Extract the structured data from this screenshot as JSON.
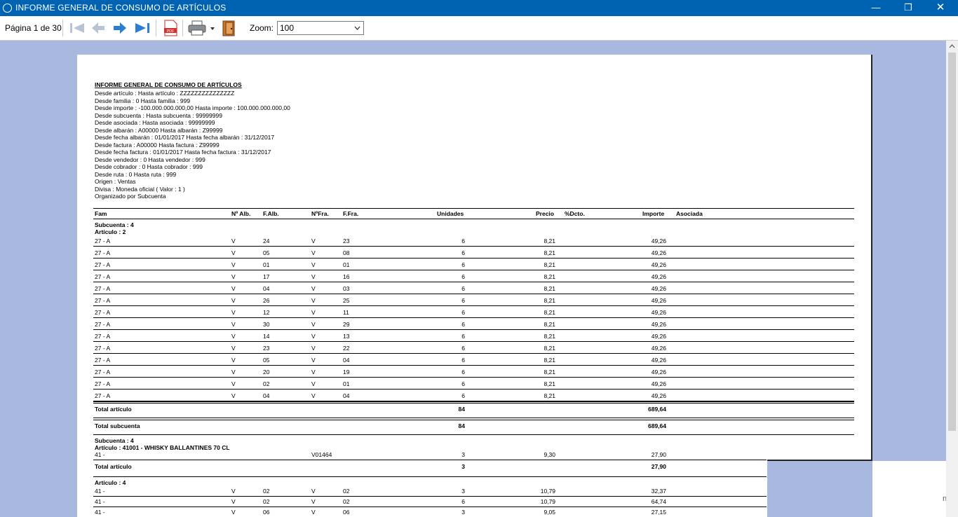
{
  "window": {
    "title": "INFORME GENERAL DE CONSUMO DE ARTÍCULOS"
  },
  "toolbar": {
    "page_indicator": "Página 1 de 30",
    "zoom_label": "Zoom:",
    "zoom_value": "100"
  },
  "report": {
    "title": "INFORME GENERAL DE CONSUMO DE ARTÍCULOS",
    "filters": [
      "Desde artículo :  Hasta artículo : ZZZZZZZZZZZZZZZ",
      "Desde familia : 0 Hasta familia : 999",
      "Desde importe : -100.000.000.000,00 Hasta importe : 100.000.000.000,00",
      "Desde subcuenta :  Hasta subcuenta : 99999999",
      "Desde asociada :  Hasta asociada : 99999999",
      "Desde albarán : A00000 Hasta albarán : Z99999",
      "Desde fecha albarán : 01/01/2017 Hasta fecha albarán : 31/12/2017",
      "Desde factura : A00000 Hasta factura : Z99999",
      "Desde fecha factura : 01/01/2017 Hasta fecha factura : 31/12/2017",
      "Desde vendedor : 0 Hasta vendedor : 999",
      "Desde cobrador : 0 Hasta cobrador : 999",
      "Desde ruta : 0 Hasta ruta : 999",
      "Origen : Ventas",
      "Divisa : Moneda oficial ( Valor : 1 )",
      "Organizado por Subcuenta"
    ],
    "columns": {
      "fam": "Fam",
      "nalb": "Nº Alb.",
      "falb": "F.Alb.",
      "nfra": "NºFra.",
      "ffra": "F.Fra.",
      "unidades": "Unidades",
      "precio": "Precio",
      "dcto": "%Dcto.",
      "importe": "Importe",
      "asociada": "Asociada"
    },
    "group1": {
      "subcuenta": "Subcuenta : 4",
      "articulo": "Artículo : 2",
      "rows": [
        {
          "fam": "27 - A",
          "nalb": "V",
          "falb": "24",
          "nfra": "V",
          "ffra": "23",
          "unidades": "6",
          "precio": "8,21",
          "importe": "49,26"
        },
        {
          "fam": "27 - A",
          "nalb": "V",
          "falb": "05",
          "nfra": "V",
          "ffra": "08",
          "unidades": "6",
          "precio": "8,21",
          "importe": "49,26"
        },
        {
          "fam": "27 - A",
          "nalb": "V",
          "falb": "01",
          "nfra": "V",
          "ffra": "01",
          "unidades": "6",
          "precio": "8,21",
          "importe": "49,26"
        },
        {
          "fam": "27 - A",
          "nalb": "V",
          "falb": "17",
          "nfra": "V",
          "ffra": "16",
          "unidades": "6",
          "precio": "8,21",
          "importe": "49,26"
        },
        {
          "fam": "27 - A",
          "nalb": "V",
          "falb": "04",
          "nfra": "V",
          "ffra": "03",
          "unidades": "6",
          "precio": "8,21",
          "importe": "49,26"
        },
        {
          "fam": "27 - A",
          "nalb": "V",
          "falb": "26",
          "nfra": "V",
          "ffra": "25",
          "unidades": "6",
          "precio": "8,21",
          "importe": "49,26"
        },
        {
          "fam": "27 - A",
          "nalb": "V",
          "falb": "12",
          "nfra": "V",
          "ffra": "11",
          "unidades": "6",
          "precio": "8,21",
          "importe": "49,26"
        },
        {
          "fam": "27 - A",
          "nalb": "V",
          "falb": "30",
          "nfra": "V",
          "ffra": "29",
          "unidades": "6",
          "precio": "8,21",
          "importe": "49,26"
        },
        {
          "fam": "27 - A",
          "nalb": "V",
          "falb": "14",
          "nfra": "V",
          "ffra": "13",
          "unidades": "6",
          "precio": "8,21",
          "importe": "49,26"
        },
        {
          "fam": "27 - A",
          "nalb": "V",
          "falb": "23",
          "nfra": "V",
          "ffra": "22",
          "unidades": "6",
          "precio": "8,21",
          "importe": "49,26"
        },
        {
          "fam": "27 - A",
          "nalb": "V",
          "falb": "05",
          "nfra": "V",
          "ffra": "04",
          "unidades": "6",
          "precio": "8,21",
          "importe": "49,26"
        },
        {
          "fam": "27 - A",
          "nalb": "V",
          "falb": "20",
          "nfra": "V",
          "ffra": "19",
          "unidades": "6",
          "precio": "8,21",
          "importe": "49,26"
        },
        {
          "fam": "27 - A",
          "nalb": "V",
          "falb": "02",
          "nfra": "V",
          "ffra": "01",
          "unidades": "6",
          "precio": "8,21",
          "importe": "49,26"
        },
        {
          "fam": "27 - A",
          "nalb": "V",
          "falb": "04",
          "nfra": "V",
          "ffra": "04",
          "unidades": "6",
          "precio": "8,21",
          "importe": "49,26"
        }
      ],
      "total_articulo": {
        "label": "Total artículo",
        "unidades": "84",
        "importe": "689,64"
      },
      "total_subcuenta": {
        "label": "Total subcuenta",
        "unidades": "84",
        "importe": "689,64"
      }
    },
    "group2": {
      "subcuenta": "Subcuenta : 4",
      "articulo": "Artículo : 41001 - WHISKY BALLANTINES 70 CL",
      "row": {
        "fam": "41 -",
        "nfra": "V01464",
        "unidades": "3",
        "precio": "9,30",
        "importe": "27,90"
      },
      "total_articulo": {
        "label": "Total artículo",
        "unidades": "3",
        "importe": "27,90"
      }
    },
    "group3": {
      "articulo": "Artículo : 4",
      "rows": [
        {
          "fam": "41 -",
          "nalb": "V",
          "falb": "02",
          "nfra": "V",
          "ffra": "02",
          "unidades": "3",
          "precio": "10,79",
          "importe": "32,37"
        },
        {
          "fam": "41 -",
          "nalb": "V",
          "falb": "02",
          "nfra": "V",
          "ffra": "02",
          "unidades": "6",
          "precio": "10,79",
          "importe": "64,74"
        },
        {
          "fam": "41 -",
          "nalb": "V",
          "falb": "06",
          "nfra": "V",
          "ffra": "06",
          "unidades": "3",
          "precio": "9,05",
          "importe": "27,15"
        }
      ]
    }
  },
  "side_text": "na"
}
